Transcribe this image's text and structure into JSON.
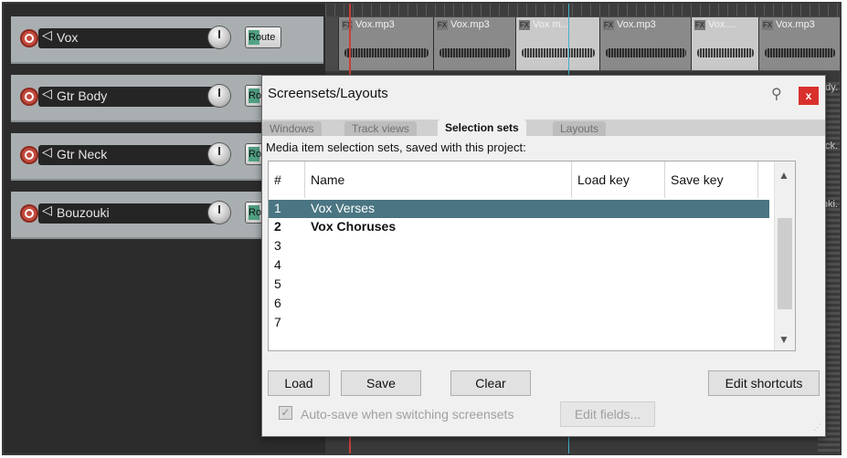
{
  "tracks": [
    {
      "name": "Vox",
      "route": "Route"
    },
    {
      "name": "Gtr Body",
      "route": "Rou"
    },
    {
      "name": "Gtr Neck",
      "route": "Rou"
    },
    {
      "name": "Bouzouki",
      "route": "Rou"
    }
  ],
  "media_items": [
    {
      "label": "Vox.mp3",
      "selected": false
    },
    {
      "label": "Vox.mp3",
      "selected": false
    },
    {
      "label": "Vox m...",
      "selected": true
    },
    {
      "label": "Vox.mp3",
      "selected": false
    },
    {
      "label": "Vox....",
      "selected": true
    },
    {
      "label": "Vox.mp3",
      "selected": false
    }
  ],
  "arrange_right_labels": [
    "dy.",
    "ck.",
    "uki."
  ],
  "fx_badge": "FX",
  "dialog": {
    "title": "Screensets/Layouts",
    "tabs": [
      "Windows",
      "Track views",
      "Selection sets",
      "Layouts"
    ],
    "active_tab": "Selection sets",
    "description": "Media item selection sets, saved with this project:",
    "columns": [
      "#",
      "Name",
      "Load key",
      "Save key"
    ],
    "rows": [
      {
        "num": "1",
        "name": "Vox Verses",
        "selected": true
      },
      {
        "num": "2",
        "name": "Vox Choruses",
        "selected": false,
        "bold": true
      },
      {
        "num": "3",
        "name": ""
      },
      {
        "num": "4",
        "name": ""
      },
      {
        "num": "5",
        "name": ""
      },
      {
        "num": "6",
        "name": ""
      },
      {
        "num": "7",
        "name": ""
      }
    ],
    "buttons": {
      "load": "Load",
      "save": "Save",
      "clear": "Clear",
      "edit_shortcuts": "Edit shortcuts"
    },
    "autosave_label": "Auto-save when switching screensets",
    "autosave_checked": true,
    "edit_fields": "Edit fields...",
    "close_glyph": "x",
    "pin_glyph": "⚲"
  },
  "colors": {
    "selected_row": "#4a7582",
    "close_button": "#d9302c",
    "track_panel": "#a9afb1"
  }
}
